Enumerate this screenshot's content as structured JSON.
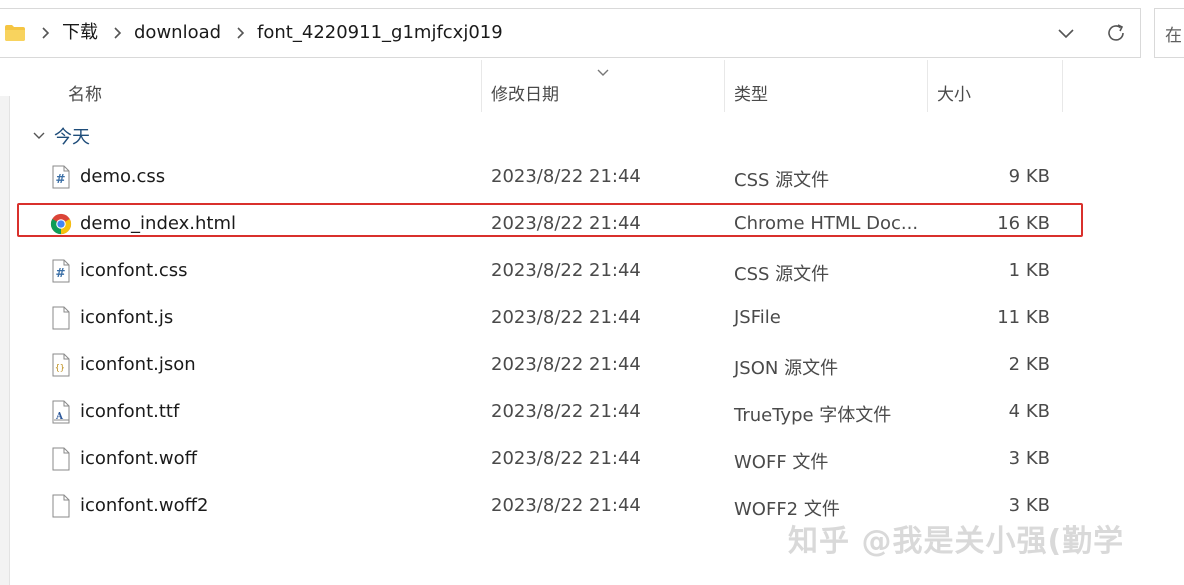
{
  "address_bar": {
    "crumbs": [
      "下载",
      "download",
      "font_4220911_g1mjfcxj019"
    ]
  },
  "search": {
    "placeholder": "在"
  },
  "columns": {
    "name": "名称",
    "date": "修改日期",
    "type": "类型",
    "size": "大小"
  },
  "group": {
    "label": "今天"
  },
  "files": [
    {
      "name": "demo.css",
      "date": "2023/8/22 21:44",
      "type": "CSS 源文件",
      "size": "9 KB",
      "icon": "css-file-icon"
    },
    {
      "name": "demo_index.html",
      "date": "2023/8/22 21:44",
      "type": "Chrome HTML Doc...",
      "size": "16 KB",
      "icon": "chrome-icon",
      "highlighted": true
    },
    {
      "name": "iconfont.css",
      "date": "2023/8/22 21:44",
      "type": "CSS 源文件",
      "size": "1 KB",
      "icon": "css-file-icon"
    },
    {
      "name": "iconfont.js",
      "date": "2023/8/22 21:44",
      "type": "JSFile",
      "size": "11 KB",
      "icon": "blank-file-icon"
    },
    {
      "name": "iconfont.json",
      "date": "2023/8/22 21:44",
      "type": "JSON 源文件",
      "size": "2 KB",
      "icon": "json-file-icon"
    },
    {
      "name": "iconfont.ttf",
      "date": "2023/8/22 21:44",
      "type": "TrueType 字体文件",
      "size": "4 KB",
      "icon": "font-file-icon"
    },
    {
      "name": "iconfont.woff",
      "date": "2023/8/22 21:44",
      "type": "WOFF 文件",
      "size": "3 KB",
      "icon": "blank-file-icon"
    },
    {
      "name": "iconfont.woff2",
      "date": "2023/8/22 21:44",
      "type": "WOFF2 文件",
      "size": "3 KB",
      "icon": "blank-file-icon"
    }
  ],
  "watermark": {
    "text": "知乎 @我是关小强(勤学"
  },
  "colors": {
    "highlight_border": "#d9302c",
    "folder": "#f5c542",
    "css_badge": "#3a6ea5"
  }
}
